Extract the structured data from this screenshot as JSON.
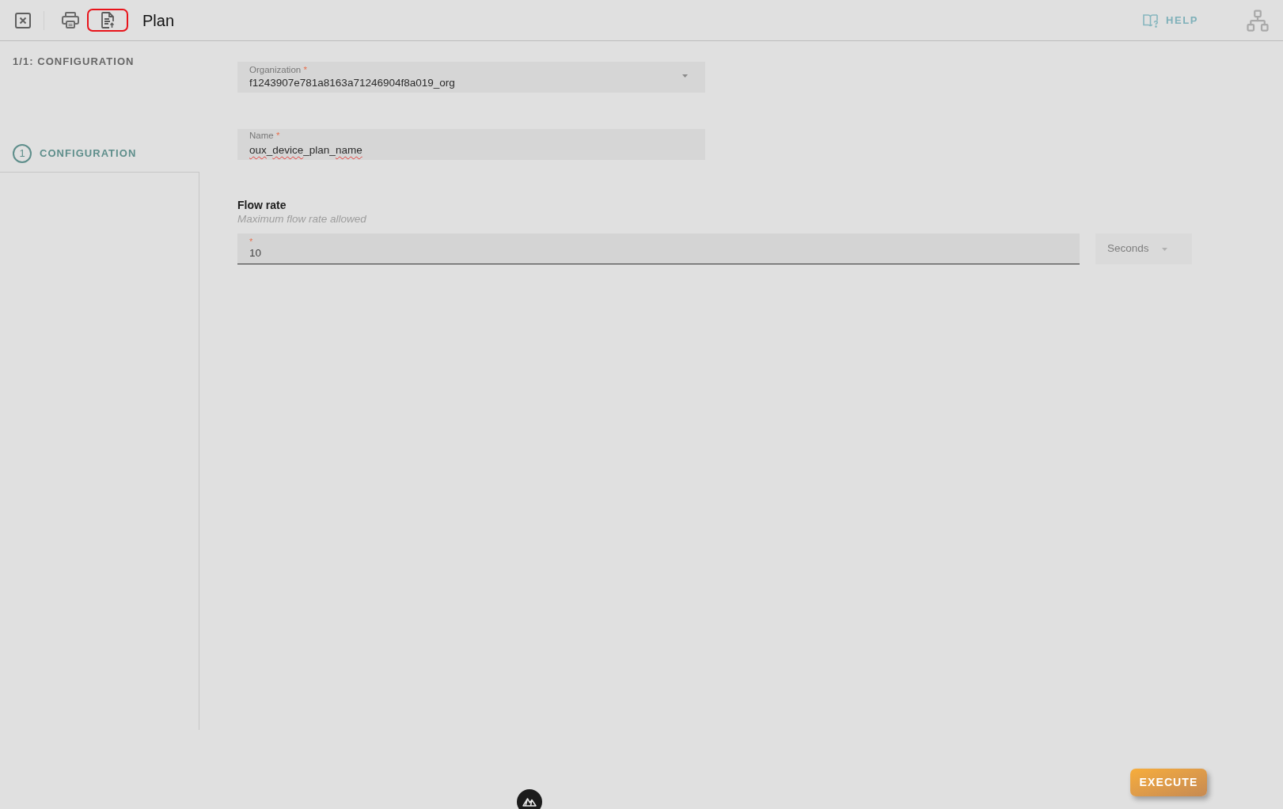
{
  "toolbar": {
    "actions": [
      {
        "kind": "close",
        "highlighted": false
      },
      {
        "kind": "print",
        "highlighted": false
      },
      {
        "kind": "export",
        "highlighted": true
      }
    ],
    "title": "Plan",
    "help": "HELP"
  },
  "sidebar": {
    "progress": "1/1: CONFIGURATION",
    "steps": [
      {
        "number": "1",
        "label": "CONFIGURATION",
        "selected": true
      }
    ]
  },
  "form": {
    "fields": [
      {
        "kind": "select",
        "label": "Organization",
        "required_mark": "*",
        "value": "f1243907e781a8163a71246904f8a019_org"
      },
      {
        "kind": "text",
        "label": "Name",
        "required_mark": "*",
        "value_parts": [
          {
            "text": "oux",
            "misspelled": true
          },
          {
            "text": "_",
            "misspelled": false
          },
          {
            "text": "device",
            "misspelled": true
          },
          {
            "text": "_plan_",
            "misspelled": false
          },
          {
            "text": "name",
            "misspelled": true
          }
        ]
      }
    ],
    "flow_rate": {
      "label": "Flow rate",
      "description": "Maximum flow rate allowed",
      "amount": {
        "required_mark": "*",
        "value": "10"
      },
      "unit": {
        "value": "Seconds",
        "disabled": true
      }
    }
  },
  "execute_button": "EXECUTE"
}
